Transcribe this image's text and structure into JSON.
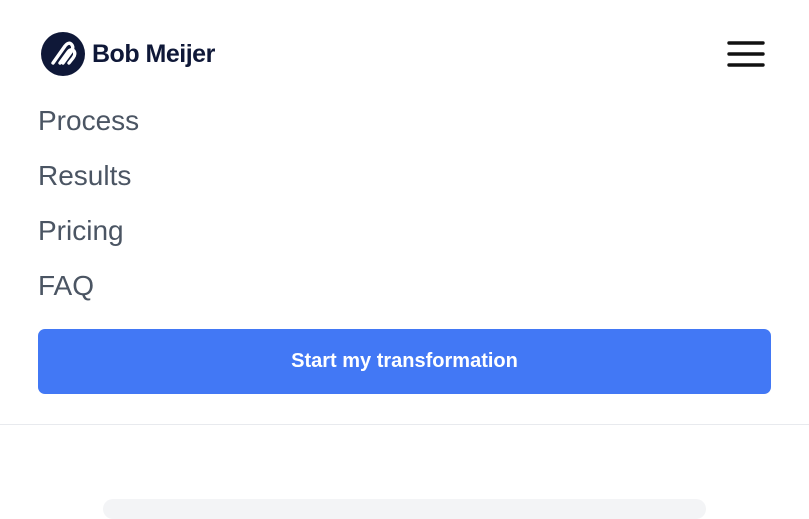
{
  "brand": {
    "name": "Bob Meijer",
    "logo_icon": "bm-monogram-icon",
    "colors": {
      "navy": "#0f1838"
    }
  },
  "header": {
    "menu_icon": "hamburger-menu-icon"
  },
  "nav": {
    "items": [
      {
        "label": "Process"
      },
      {
        "label": "Results"
      },
      {
        "label": "Pricing"
      },
      {
        "label": "FAQ"
      }
    ]
  },
  "cta": {
    "label": "Start my transformation",
    "color": "#4278f5"
  }
}
